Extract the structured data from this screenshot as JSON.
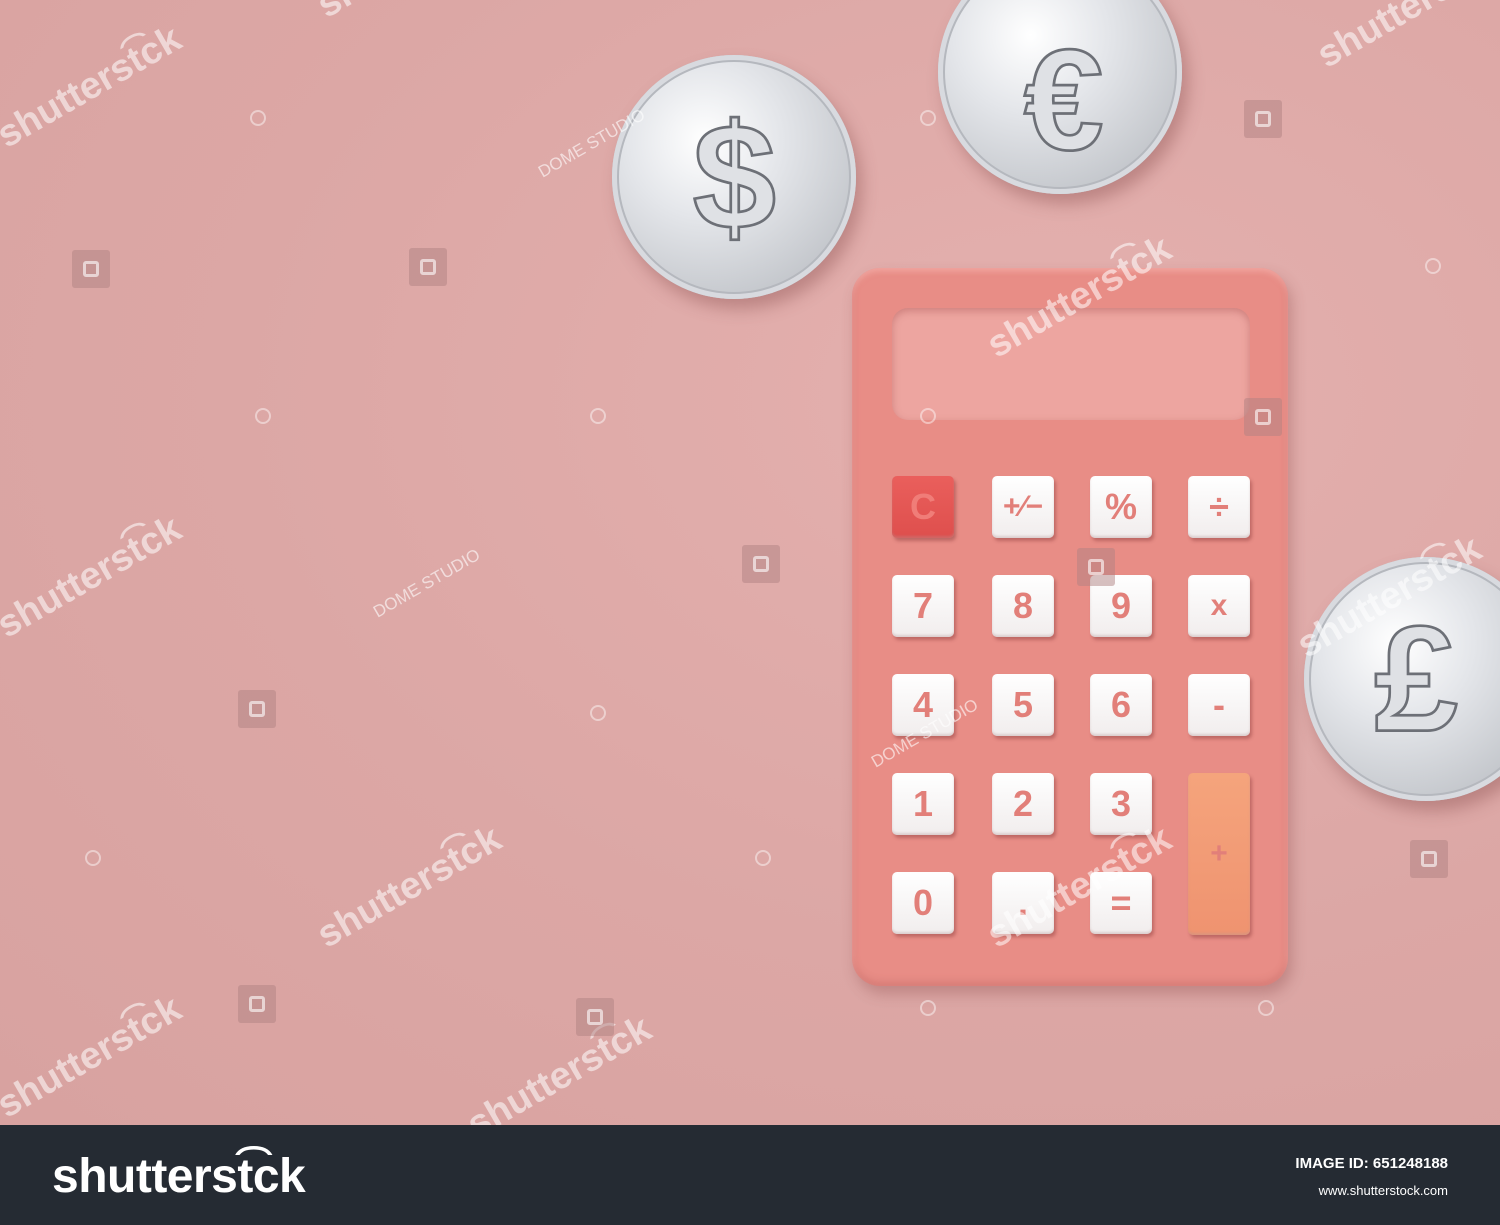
{
  "watermark": {
    "brand": "shutterst͡ck",
    "studio": "DOME STUDIO"
  },
  "coins": [
    "dollar-coin",
    "euro-coin",
    "pound-coin"
  ],
  "calculator": {
    "color": "#e88d86",
    "keys": {
      "clear": "C",
      "sign": "+⁄−",
      "percent": "%",
      "divide": "÷",
      "k7": "7",
      "k8": "8",
      "k9": "9",
      "multiply": "x",
      "k4": "4",
      "k5": "5",
      "k6": "6",
      "minus": "-",
      "k1": "1",
      "k2": "2",
      "k3": "3",
      "plus": "+",
      "k0": "0",
      "dot": ".",
      "equals": "="
    }
  },
  "footer": {
    "logo": "shutterst͡ck",
    "image_id_label": "IMAGE ID: 651248188",
    "url": "www.shutterstock.com"
  }
}
